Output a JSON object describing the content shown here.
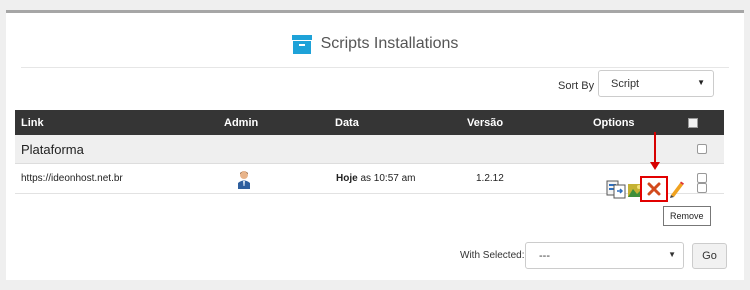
{
  "panel": {
    "title": "Scripts Installations",
    "title_icon": "archive-box-icon",
    "accent": "#1ea2d8"
  },
  "sort": {
    "label": "Sort By :",
    "value": "Script"
  },
  "table": {
    "columns": [
      "Link",
      "Admin",
      "Data",
      "Versão",
      "Options"
    ],
    "header_bg": "#353535",
    "group": "Plataforma",
    "rows": [
      {
        "link": "https://ideonhost.net.br",
        "date_bold": "Hoje",
        "date_rest": " as 10:57 am",
        "version": "1.2.12",
        "admin_icon": "user-admin-icon",
        "options": [
          "clone-icon",
          "backup-icon",
          "remove-icon",
          "edit-icon"
        ]
      }
    ]
  },
  "tooltip": "Remove",
  "bulk": {
    "label": "With Selected:",
    "value": "---",
    "go_label": "Go"
  },
  "highlight_color": "#e20000"
}
